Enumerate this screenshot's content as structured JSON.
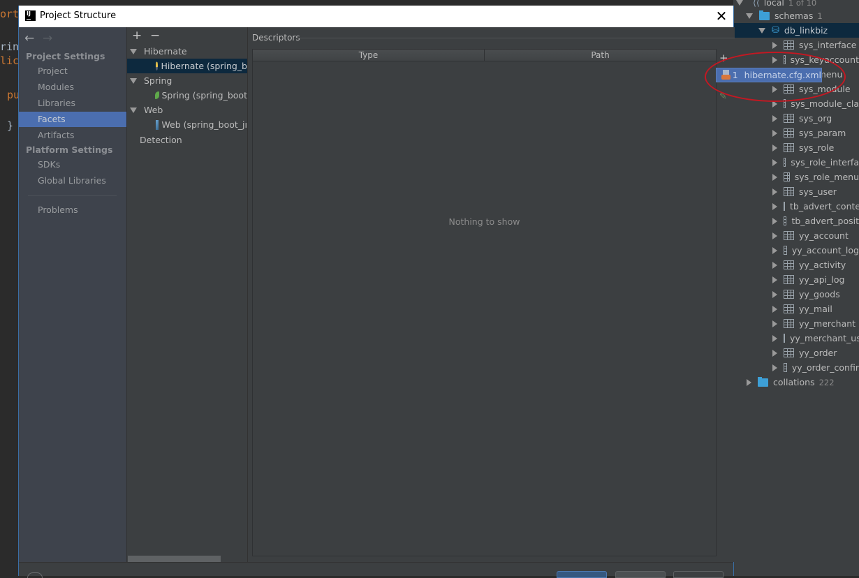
{
  "editor": {
    "lines": [
      {
        "text": "ort",
        "color": "#cc7832"
      },
      {
        "text": "rin",
        "color": "#a9b7c6"
      },
      {
        "text": "lic",
        "color": "#cc7832"
      },
      {
        "text": "pu",
        "color": "#cc7832"
      },
      {
        "text": "}",
        "color": "#a9b7c6"
      }
    ]
  },
  "dialog": {
    "title": "Project Structure",
    "logo_text": "IJ",
    "close_glyph": "✕",
    "nav": {
      "back_glyph": "←",
      "forward_glyph": "→",
      "sections": [
        {
          "header": "Project Settings",
          "items": [
            "Project",
            "Modules",
            "Libraries",
            "Facets",
            "Artifacts"
          ]
        },
        {
          "header": "Platform Settings",
          "items": [
            "SDKs",
            "Global Libraries"
          ]
        }
      ],
      "extra_items": [
        "Problems"
      ],
      "selected": "Facets"
    },
    "facets": {
      "add_glyph": "+",
      "remove_glyph": "−",
      "tree": [
        {
          "label": "Hibernate",
          "type": "group"
        },
        {
          "label": "Hibernate (spring_b",
          "type": "facet",
          "icon": "hibernate-icon",
          "selected": true
        },
        {
          "label": "Spring",
          "type": "group"
        },
        {
          "label": "Spring (spring_boot",
          "type": "facet",
          "icon": "spring-leaf-icon"
        },
        {
          "label": "Web",
          "type": "group"
        },
        {
          "label": "Web (spring_boot_jı",
          "type": "facet",
          "icon": "web-icon"
        },
        {
          "label": "Detection",
          "type": "item"
        }
      ]
    },
    "descriptors": {
      "label": "Descriptors",
      "columns": [
        "Type",
        "Path"
      ],
      "empty_text": "Nothing to show",
      "add_glyph": "+",
      "edit_glyph": "✎"
    }
  },
  "popup": {
    "index": "1",
    "label": "hibernate.cfg.xml"
  },
  "db_panel": {
    "root": {
      "label": "local",
      "count": "1 of 10"
    },
    "schemas": {
      "label": "schemas",
      "count": "1"
    },
    "database": "db_linkbiz",
    "tables": [
      "sys_interface",
      "sys_keyaccount",
      "sys_menu",
      "sys_module",
      "sys_module_cla",
      "sys_org",
      "sys_param",
      "sys_role",
      "sys_role_interfa",
      "sys_role_menu",
      "sys_user",
      "tb_advert_conte",
      "tb_advert_posit",
      "yy_account",
      "yy_account_log",
      "yy_activity",
      "yy_api_log",
      "yy_goods",
      "yy_mail",
      "yy_merchant",
      "yy_merchant_us",
      "yy_order",
      "yy_order_confir"
    ],
    "collations": {
      "label": "collations",
      "count": "222"
    }
  },
  "colors": {
    "selection": "#4b6eaf",
    "tree_selection": "#0d293e",
    "annotation_ellipse": "#c41822",
    "folder": "#3d9fd6"
  }
}
